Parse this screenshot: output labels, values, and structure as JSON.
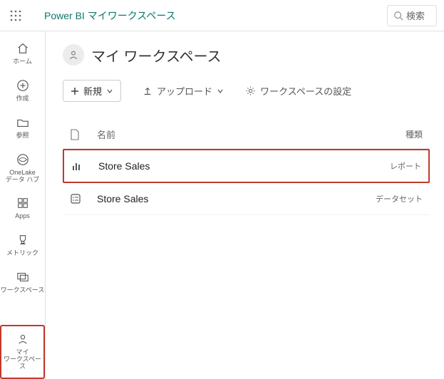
{
  "topbar": {
    "brand": "Power BI マイワークスペース",
    "search_label": "検索"
  },
  "sidebar": {
    "items": [
      {
        "label": "ホーム",
        "icon": "home"
      },
      {
        "label": "作成",
        "icon": "plus-circle"
      },
      {
        "label": "参照",
        "icon": "folder"
      },
      {
        "label": "OneLake\nデータ ハブ",
        "icon": "onelake"
      },
      {
        "label": "Apps",
        "icon": "apps"
      },
      {
        "label": "メトリック",
        "icon": "trophy"
      },
      {
        "label": "ワークスペース",
        "icon": "workspaces"
      },
      {
        "label": "マイ\nワークスペース",
        "icon": "person"
      }
    ]
  },
  "workspace": {
    "title": "マイ ワークスペース"
  },
  "toolbar": {
    "new_label": "新規",
    "upload_label": "アップロード",
    "settings_label": "ワークスペースの設定"
  },
  "list": {
    "header": {
      "name": "名前",
      "type": "種類"
    },
    "rows": [
      {
        "name": "Store Sales",
        "type_label": "レポート",
        "icon": "report",
        "highlight": true
      },
      {
        "name": "Store Sales",
        "type_label": "データセット",
        "icon": "dataset",
        "highlight": false
      }
    ]
  }
}
